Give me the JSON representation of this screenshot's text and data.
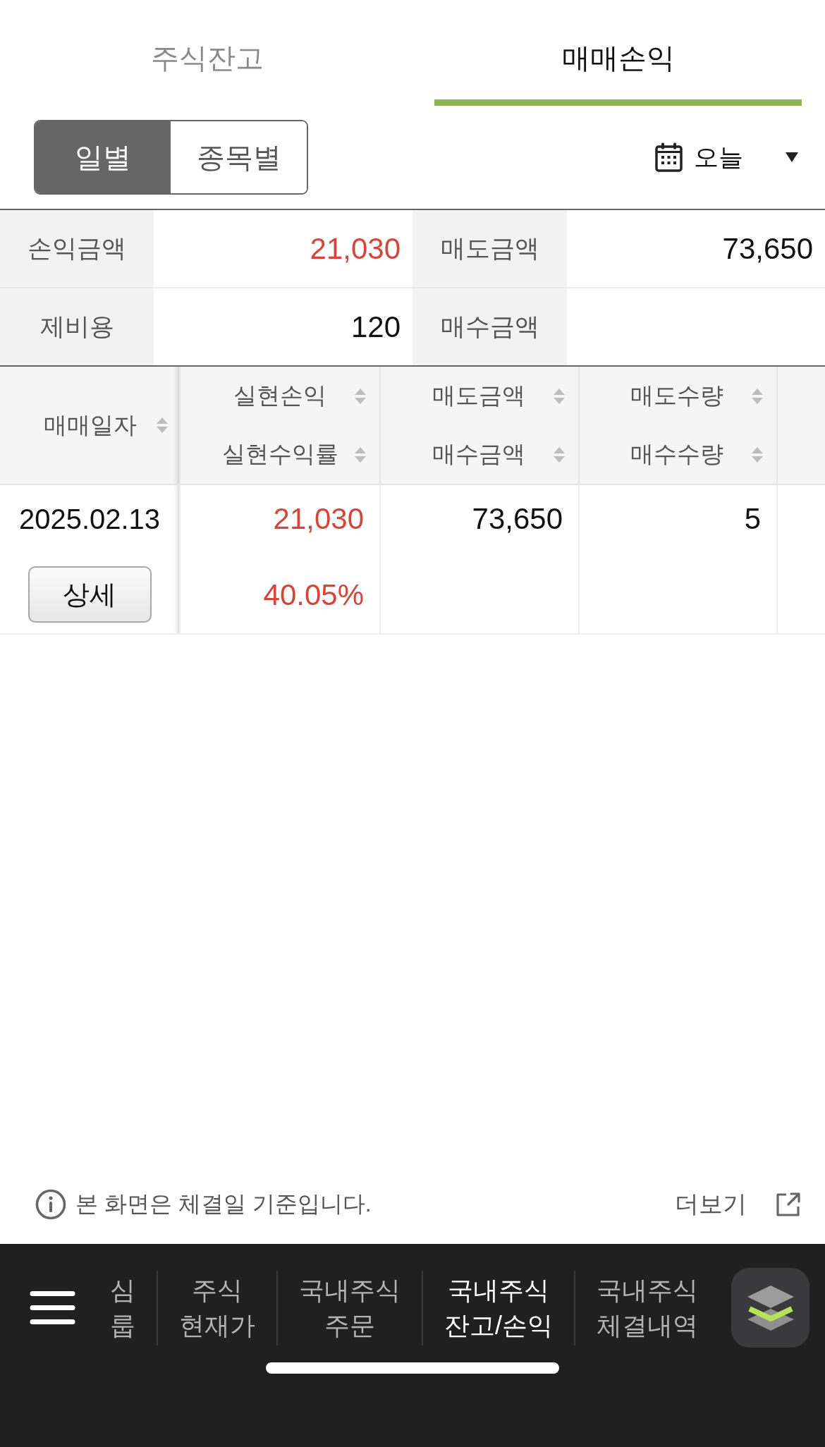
{
  "tabs": [
    {
      "label": "주식잔고",
      "selected": false
    },
    {
      "label": "매매손익",
      "selected": true
    }
  ],
  "view_toggle": [
    {
      "label": "일별",
      "selected": true
    },
    {
      "label": "종목별",
      "selected": false
    }
  ],
  "date_filter": {
    "label": "오늘"
  },
  "summary": [
    {
      "label": "손익금액",
      "value": "21,030",
      "color": "#d4453b"
    },
    {
      "label": "매도금액",
      "value": "73,650",
      "color": "#111111"
    },
    {
      "label": "제비용",
      "value": "120",
      "color": "#111111"
    },
    {
      "label": "매수금액"
    }
  ],
  "table": {
    "columns": [
      {
        "labels": [
          "매매일자"
        ]
      },
      {
        "labels": [
          "실현손익",
          "실현수익률"
        ]
      },
      {
        "labels": [
          "매도금액",
          "매수금액"
        ]
      },
      {
        "labels": [
          "매도수량",
          "매수수량"
        ]
      }
    ],
    "rows": [
      {
        "date": "2025.02.13",
        "detail_button": "상세",
        "values": [
          [
            {
              "text": "21,030",
              "color": "#d4453b"
            },
            {
              "text": "40.05%",
              "color": "#d4453b"
            }
          ],
          [
            {
              "text": "73,650",
              "color": "#111111"
            }
          ],
          [
            {
              "text": "5",
              "color": "#111111"
            }
          ]
        ]
      }
    ]
  },
  "notice": {
    "text": "본 화면은 체결일 기준입니다.",
    "more_link": "더보기"
  },
  "bottom_nav": {
    "items": [
      {
        "lines": [
          "심",
          "룹"
        ],
        "selected": false
      },
      {
        "lines": [
          "주식",
          "현재가"
        ],
        "selected": false
      },
      {
        "lines": [
          "국내주식",
          "주문"
        ],
        "selected": false
      },
      {
        "lines": [
          "국내주식",
          "잔고/손익"
        ],
        "selected": true
      },
      {
        "lines": [
          "국내주식",
          "체결내역"
        ],
        "selected": false
      }
    ]
  }
}
